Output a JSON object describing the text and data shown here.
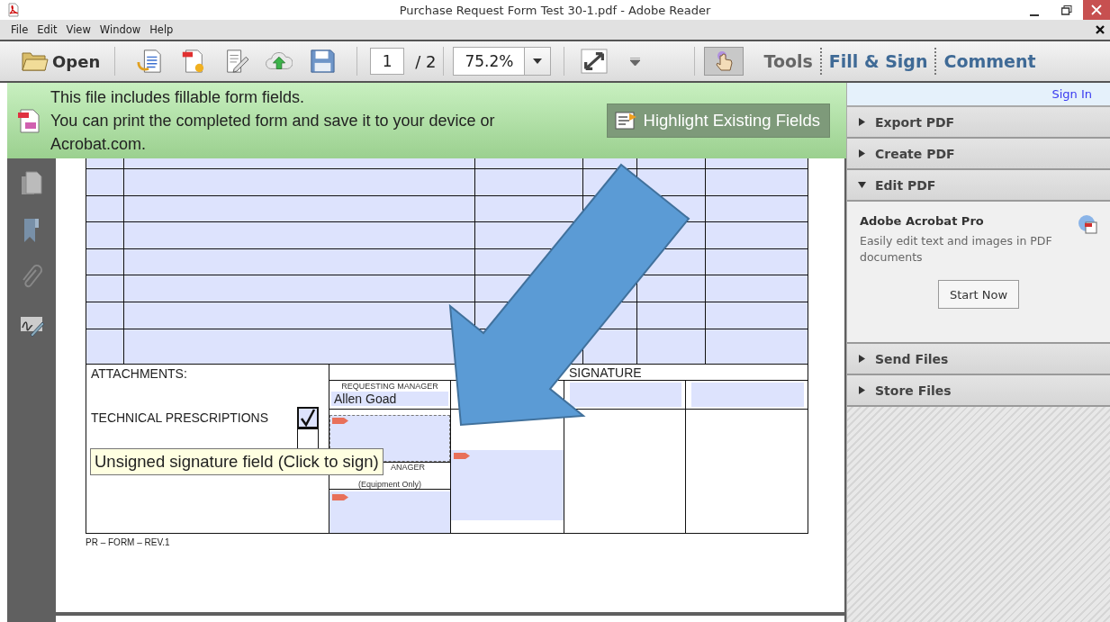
{
  "window": {
    "title": "Purchase Request Form Test 30-1.pdf - Adobe Reader"
  },
  "menu": [
    "File",
    "Edit",
    "View",
    "Window",
    "Help"
  ],
  "toolbar": {
    "open_label": "Open",
    "page": "1",
    "page_total": "/ 2",
    "zoom": "75.2%",
    "hand_tool": {
      "pressed": true
    },
    "panes": [
      {
        "label": "Tools",
        "selected": true
      },
      {
        "label": "Fill & Sign",
        "selected": false
      },
      {
        "label": "Comment",
        "selected": false
      }
    ]
  },
  "notice": {
    "lines": [
      "This file includes fillable form fields.",
      "You can print the completed form and save it to your device or Acrobat.com."
    ],
    "button": "Highlight Existing Fields"
  },
  "form": {
    "attachments_title": "ATTACHMENTS:",
    "attachments": [
      {
        "label": "TECHNICAL PRESCRIPTIONS",
        "checked": true
      },
      {
        "checked": false
      }
    ],
    "signature_heading": "SIGNATURE",
    "requesting_manager": {
      "label": "REQUESTING MANAGER",
      "value": "Allen Goad"
    },
    "second_manager": {
      "label": "ANAGER",
      "note": "(Equipment Only)"
    },
    "footer": "PR – FORM – REV.1"
  },
  "tooltip": "Unsigned signature field (Click to sign)",
  "right_panel": {
    "sign_in": "Sign In",
    "sections": [
      {
        "title": "Export PDF",
        "expanded": false
      },
      {
        "title": "Create PDF",
        "expanded": false
      },
      {
        "title": "Edit PDF",
        "expanded": true,
        "promo": {
          "title": "Adobe Acrobat Pro",
          "text": "Easily edit text and images in PDF documents",
          "button": "Start Now"
        }
      },
      {
        "title": "Send Files",
        "expanded": false
      },
      {
        "title": "Store Files",
        "expanded": false
      }
    ]
  }
}
